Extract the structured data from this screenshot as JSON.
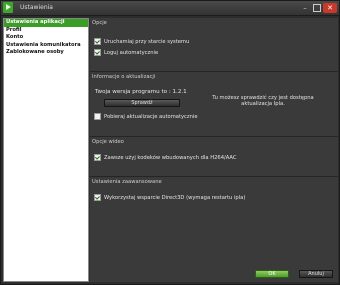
{
  "window": {
    "title": "Ustawienia"
  },
  "sidebar": {
    "items": [
      {
        "label": "Ustawienia aplikacji",
        "active": true
      },
      {
        "label": "Profil",
        "active": false
      },
      {
        "label": "Konto",
        "active": false
      },
      {
        "label": "Ustawienia komunikatora",
        "active": false
      },
      {
        "label": "Zablokowane osoby",
        "active": false
      }
    ]
  },
  "sections": {
    "options": {
      "title": "Opcje",
      "items": [
        {
          "label": "Uruchamiaj przy starcie systemu",
          "checked": true
        },
        {
          "label": "Loguj automatycznie",
          "checked": true
        }
      ]
    },
    "updates": {
      "title": "Informacje o aktualizacji",
      "version_text": "Twoja wersja programu to : 1.2.1",
      "check_button": "Sprawdź",
      "info_text": "Tu możesz sprawdzić czy jest dostępna aktualizacja Ipla.",
      "auto_update": {
        "label": "Pobieraj aktualizacje automatycznie",
        "checked": false
      }
    },
    "video": {
      "title": "Opcje wideo",
      "items": [
        {
          "label": "Zawsze użyj kodeków wbudowanych dla H264/AAC",
          "checked": true
        }
      ]
    },
    "advanced": {
      "title": "Ustawienia zaawansowane",
      "items": [
        {
          "label": "Wykorzystaj wsparcie Direct3D (wymaga restartu ipla)",
          "checked": true
        }
      ]
    }
  },
  "footer": {
    "ok_label": "OK",
    "cancel_label": "Anuluj"
  },
  "colors": {
    "accent": "#3a9d25",
    "background": "#3a3a3a",
    "sidebar": "#ffffff",
    "close": "#c8392b"
  }
}
